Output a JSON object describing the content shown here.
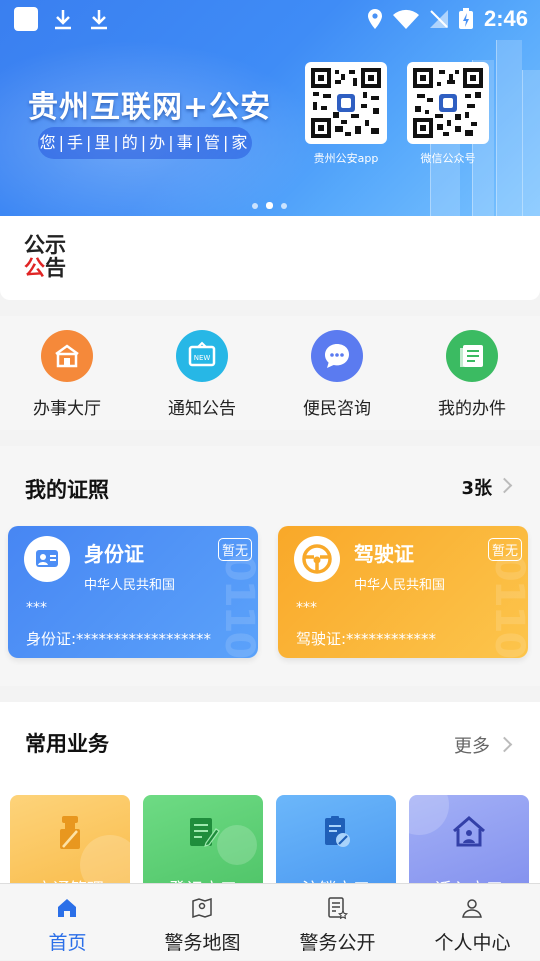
{
  "status_bar": {
    "time": "2:46"
  },
  "banner": {
    "title": "贵州互联网+公安",
    "subtitle": "您|手|里|的|办|事|管|家",
    "qr_codes": [
      {
        "label": "贵州公安app"
      },
      {
        "label": "微信公众号"
      }
    ]
  },
  "notice": {
    "logo_line1": "公示",
    "logo_line2_red": "公",
    "logo_line2_black": "告"
  },
  "quick_actions": [
    {
      "label": "办事大厅",
      "color": "#f5893a"
    },
    {
      "label": "通知公告",
      "color": "#27b7e6"
    },
    {
      "label": "便民咨询",
      "color": "#5b7bf0"
    },
    {
      "label": "我的办件",
      "color": "#3bbb62"
    }
  ],
  "licenses": {
    "title": "我的证照",
    "count": "3张",
    "cards": [
      {
        "title": "身份证",
        "subtitle": "中华人民共和国",
        "badge": "暂无",
        "masked_name": "***",
        "number_label": "身份证:******************",
        "color": "#4d8ef5"
      },
      {
        "title": "驾驶证",
        "subtitle": "中华人民共和国",
        "badge": "暂无",
        "masked_name": "***",
        "number_label": "驾驶证:************",
        "color": "#f8b332"
      }
    ]
  },
  "common_services": {
    "title": "常用业务",
    "more": "更多",
    "items": [
      {
        "label": "交通管理",
        "color": "#fbc45a",
        "icon": "traffic-officer-icon"
      },
      {
        "label": "登记户口",
        "color": "#5ccf73",
        "icon": "register-edit-icon"
      },
      {
        "label": "注销户口",
        "color": "#56a9f7",
        "icon": "cancel-register-icon"
      },
      {
        "label": "迁入户口",
        "color": "#8e9cf3",
        "icon": "move-in-house-icon"
      }
    ]
  },
  "tab_bar": {
    "items": [
      {
        "label": "首页",
        "active": true
      },
      {
        "label": "警务地图",
        "active": false
      },
      {
        "label": "警务公开",
        "active": false
      },
      {
        "label": "个人中心",
        "active": false
      }
    ]
  },
  "accent_color": "#2b6fe8"
}
